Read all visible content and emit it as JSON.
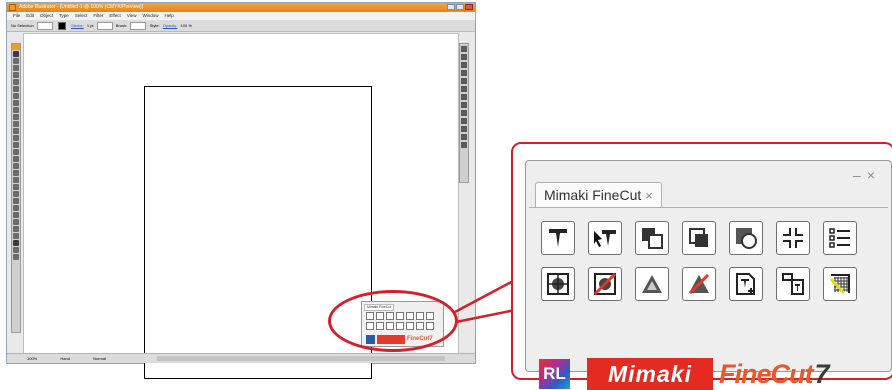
{
  "window": {
    "title": "Adobe Illustrator - [Untitled-1 @ 100% (CMYK/Preview)]"
  },
  "menu": [
    "File",
    "Edit",
    "Object",
    "Type",
    "Select",
    "Filter",
    "Effect",
    "View",
    "Window",
    "Help"
  ],
  "options_bar": {
    "selection": "No Selection",
    "stroke_label": "Stroke:",
    "stroke_weight": "1 pt",
    "brush_label": "Brush:",
    "style_label": "Style:",
    "opacity_label": "Opacity:",
    "opacity_value": "100",
    "percent": "%"
  },
  "status_bar": {
    "zoom": "100%",
    "tool": "Hand",
    "mode": "Normal"
  },
  "panel": {
    "title": "Mimaki FineCut",
    "close_glyph": "×",
    "minimize_glyph": "–",
    "window_close_glyph": "×",
    "tools": [
      "plot-icon",
      "send-to-plotter-icon",
      "create-register-mark-icon",
      "layer-frame-icon",
      "cut-frame-icon",
      "crop-mark-icon",
      "list-icon",
      "register-mark-icon",
      "remove-mark-icon",
      "outline-icon",
      "delete-outline-icon",
      "plot-file-icon",
      "output-layout-icon",
      "hatch-icon"
    ],
    "brand": {
      "rl": "RL",
      "mimaki": "Mimaki",
      "finecut": "FineCut",
      "version": "7"
    }
  },
  "mini_panel": {
    "title": "Mimaki FineCut",
    "brand": "FineCut7"
  },
  "colors": {
    "accent_red": "#d5202a",
    "mimaki_red": "#e42b22",
    "finecut_orange": "#e9582a",
    "illustrator_orange": "#f39a25"
  }
}
